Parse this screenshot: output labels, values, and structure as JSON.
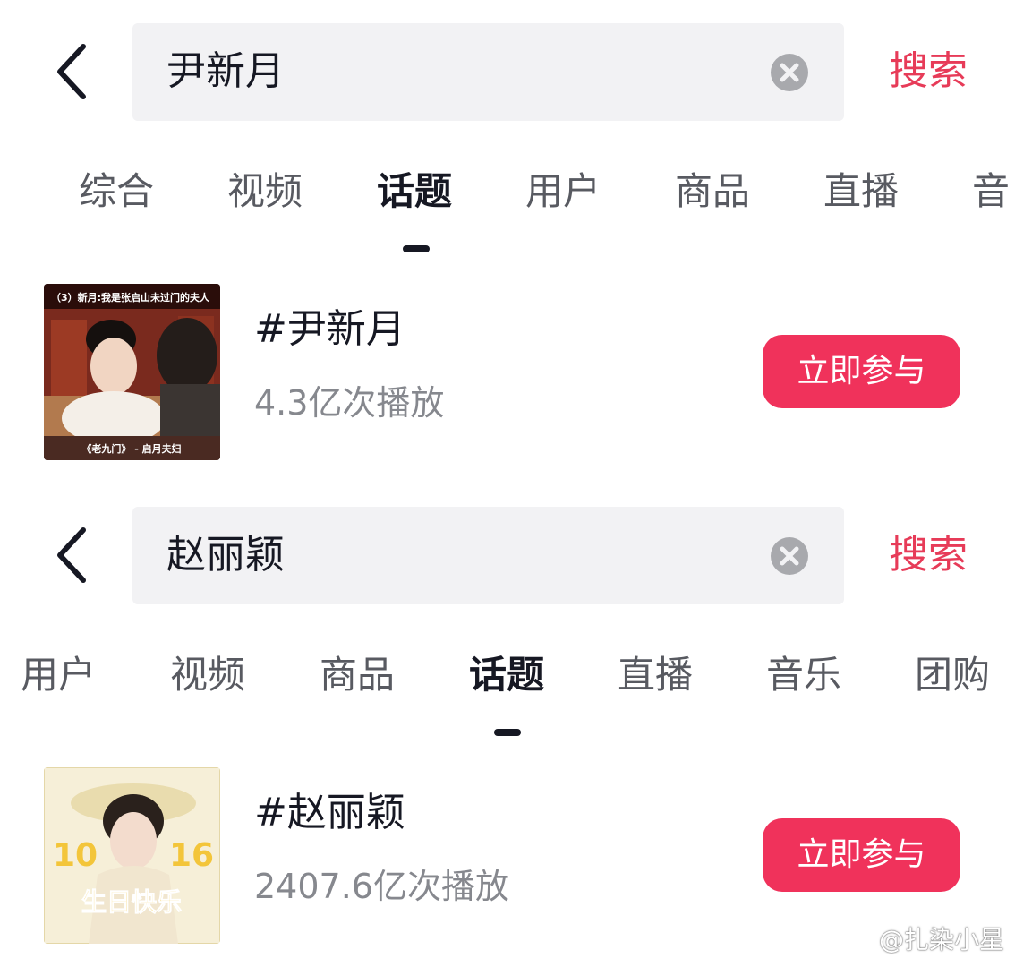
{
  "panels": [
    {
      "search": {
        "query": "尹新月",
        "action_label": "搜索"
      },
      "tabs": [
        "综合",
        "视频",
        "话题",
        "用户",
        "商品",
        "直播",
        "音"
      ],
      "active_tab": "话题",
      "result": {
        "title": "#尹新月",
        "stats": "4.3亿次播放",
        "button_label": "立即参与",
        "thumbnail": {
          "caption_top": "（3）新月:我是张启山未过门的夫人",
          "caption_bottom": "《老九门》 - 启月夫妇"
        }
      }
    },
    {
      "search": {
        "query": "赵丽颖",
        "action_label": "搜索"
      },
      "tabs": [
        "用户",
        "视频",
        "商品",
        "话题",
        "直播",
        "音乐",
        "团购"
      ],
      "active_tab": "话题",
      "result": {
        "title": "#赵丽颖",
        "stats": "2407.6亿次播放",
        "button_label": "立即参与",
        "thumbnail": {
          "text_left": "10",
          "text_right": "16",
          "text_banner": "生日快乐"
        }
      }
    }
  ],
  "watermark": {
    "text": "@扎染小星"
  },
  "colors": {
    "accent_red": "#f0325b",
    "search_red": "#e73b58",
    "search_bg": "#f2f2f4",
    "text_primary": "#161823",
    "text_secondary": "#86888e"
  },
  "icons": [
    "back-arrow-icon",
    "clear-icon",
    "weibo-icon"
  ]
}
